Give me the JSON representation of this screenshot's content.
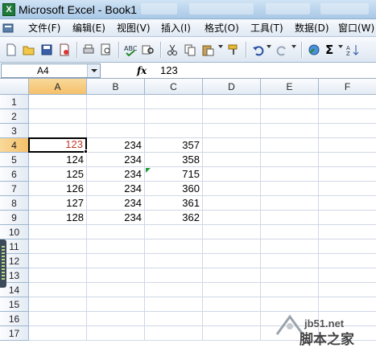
{
  "window": {
    "title": "Microsoft Excel - Book1",
    "app_icon_letter": "X"
  },
  "menu": [
    "文件(F)",
    "编辑(E)",
    "视图(V)",
    "插入(I)",
    "格式(O)",
    "工具(T)",
    "数据(D)",
    "窗口(W)"
  ],
  "toolbar": {
    "icons": [
      "new-icon",
      "open-icon",
      "save-icon",
      "permission-icon",
      "print-icon",
      "print-preview-icon",
      "spelling-icon",
      "research-icon",
      "cut-icon",
      "copy-icon",
      "paste-icon",
      "format-painter-icon",
      "undo-icon",
      "redo-icon",
      "hyperlink-icon",
      "autosum-icon",
      "sort-icon"
    ],
    "sum_symbol": "Σ"
  },
  "formula_bar": {
    "name_box": "A4",
    "fx_label": "fx",
    "formula": "123"
  },
  "grid": {
    "columns": [
      "A",
      "B",
      "C",
      "D",
      "E",
      "F"
    ],
    "active_column": "A",
    "rows": [
      "1",
      "2",
      "3",
      "4",
      "5",
      "6",
      "7",
      "8",
      "9",
      "10",
      "11",
      "12",
      "13",
      "14",
      "15",
      "16",
      "17"
    ],
    "active_row": "4",
    "active_cell": "A4",
    "cells": {
      "A4": "123",
      "B4": "234",
      "C4": "357",
      "A5": "124",
      "B5": "234",
      "C5": "358",
      "A6": "125",
      "B6": "234",
      "C6": "715",
      "A7": "126",
      "B7": "234",
      "C7": "360",
      "A8": "127",
      "B8": "234",
      "C8": "361",
      "A9": "128",
      "B9": "234",
      "C9": "362"
    }
  },
  "watermark": {
    "url": "jb51.net",
    "text": "脚本之家"
  },
  "colors": {
    "active_header": "#f5c06a",
    "selected_value": "#c0392b",
    "error_indicator": "#1f9a3a"
  }
}
